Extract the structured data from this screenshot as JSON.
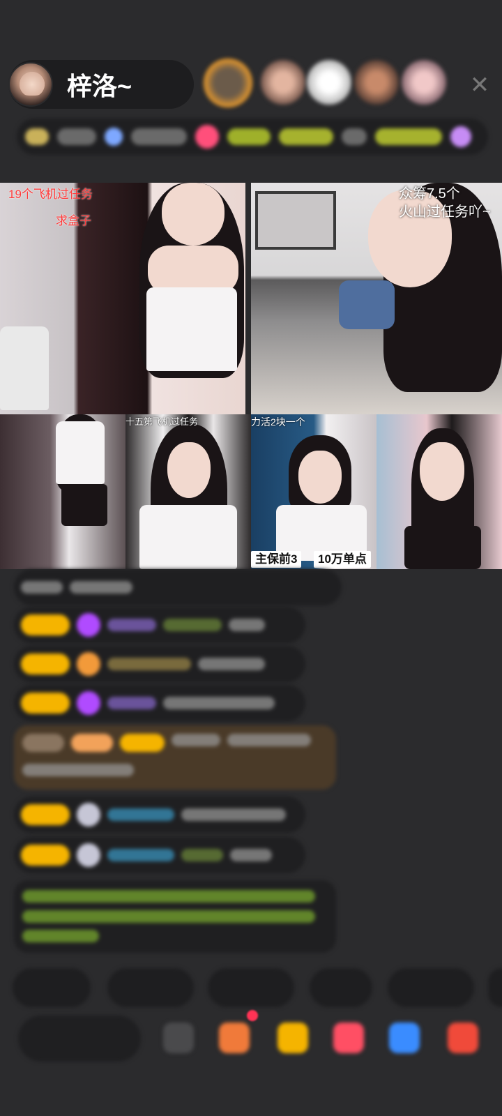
{
  "host": {
    "name": "梓洛~"
  },
  "close_icon": "close-icon",
  "tiles": [
    {
      "id": "tile-1",
      "captions": [
        "19个飞机过任务",
        "求盒子"
      ]
    },
    {
      "id": "tile-2",
      "captions": [
        "众筹7.5个",
        "火山过任务吖~"
      ]
    },
    {
      "id": "tile-3",
      "captions": []
    },
    {
      "id": "tile-4",
      "captions": [
        "十五第飞机过任务"
      ]
    },
    {
      "id": "tile-5",
      "captions": [
        "力活2块一个",
        "主保前3",
        "10万单点"
      ]
    },
    {
      "id": "tile-6",
      "captions": []
    }
  ],
  "colors": {
    "background": "#2b2b2d",
    "accent_yellow": "#f5b400",
    "accent_purple": "#b04bff",
    "accent_red": "#ff3b3b"
  }
}
